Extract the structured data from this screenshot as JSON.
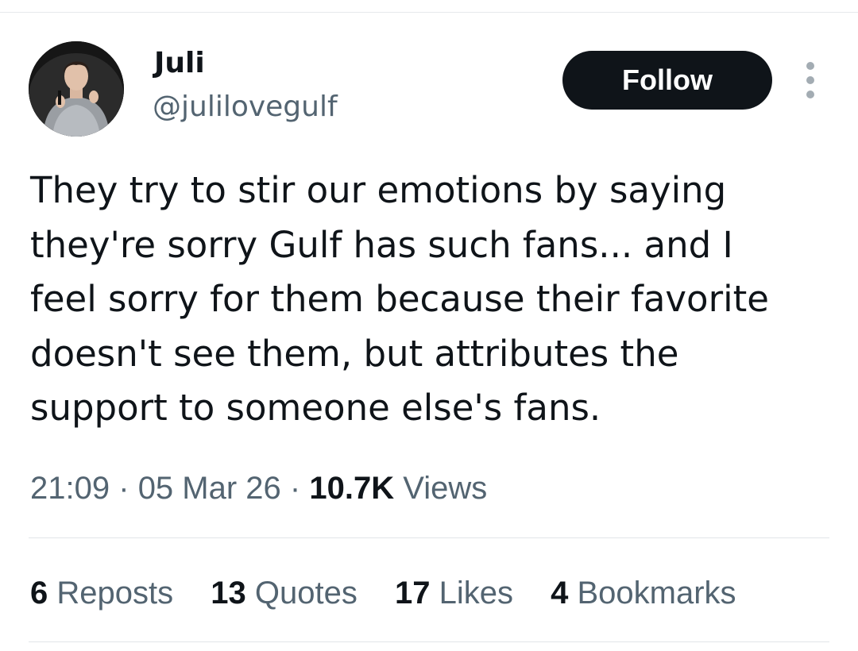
{
  "author": {
    "display_name": "Juli",
    "handle": "@julilovegulf",
    "avatar_icon": "profile-photo"
  },
  "follow_button": {
    "label": "Follow"
  },
  "more_menu": {
    "icon": "more-vertical-icon"
  },
  "tweet": {
    "text_lines": [
      "They try to stir our emotions by saying",
      "they're sorry Gulf has such fans... and I",
      "feel sorry for them because their favorite",
      "doesn't see them, but attributes the",
      "support to someone else's fans."
    ]
  },
  "meta": {
    "time": "21:09",
    "separator": "·",
    "date": "05 Mar 26",
    "views_count": "10.7K",
    "views_label": "Views"
  },
  "stats": [
    {
      "count": "6",
      "label": "Reposts"
    },
    {
      "count": "13",
      "label": "Quotes"
    },
    {
      "count": "17",
      "label": "Likes"
    },
    {
      "count": "4",
      "label": "Bookmarks"
    }
  ],
  "colors": {
    "primary_text": "#0f1419",
    "secondary_text": "#536471",
    "follow_bg": "#0f1419",
    "follow_text": "#ffffff",
    "divider": "#e1e5e8"
  }
}
